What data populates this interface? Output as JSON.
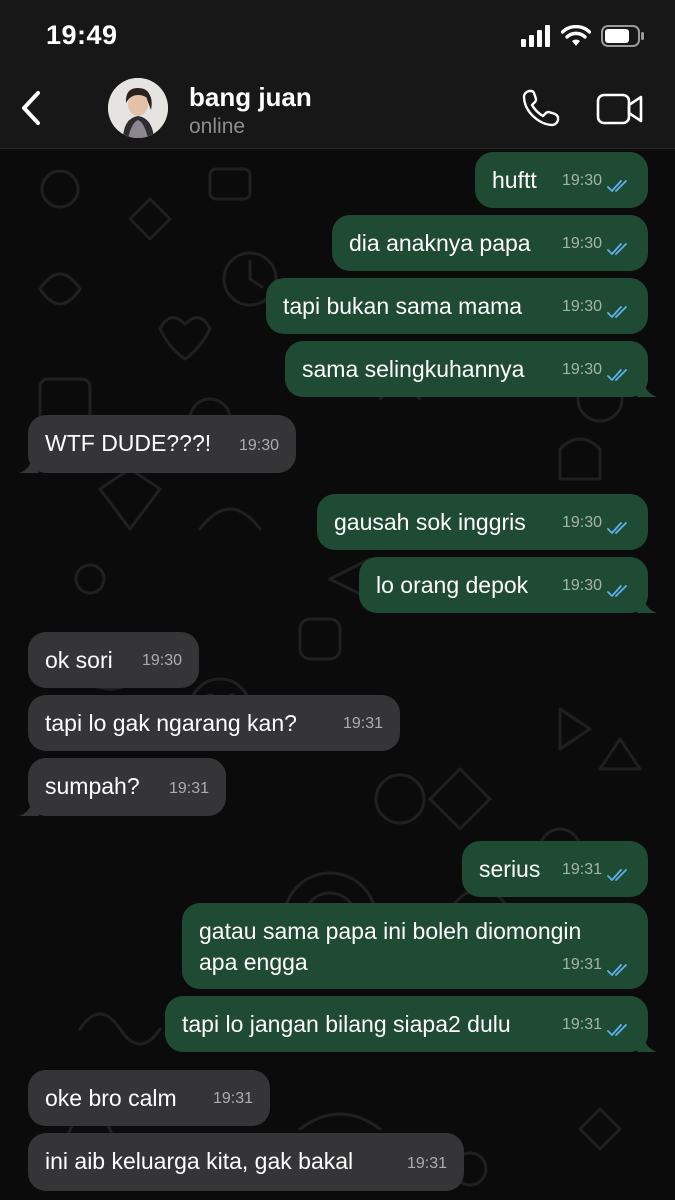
{
  "status_bar": {
    "time": "19:49"
  },
  "header": {
    "contact_name": "bang juan",
    "contact_status": "online"
  },
  "colors": {
    "outgoing_bubble": "#1f4a33",
    "incoming_bubble": "#353537",
    "read_check": "#5fb0f0",
    "background": "#0b0b0b"
  },
  "messages": [
    {
      "dir": "out",
      "text": "huftt",
      "time": "19:30",
      "read": true
    },
    {
      "dir": "out",
      "text": "dia anaknya papa",
      "time": "19:30",
      "read": true
    },
    {
      "dir": "out",
      "text": "tapi bukan sama mama",
      "time": "19:30",
      "read": true
    },
    {
      "dir": "out",
      "text": "sama selingkuhannya",
      "time": "19:30",
      "read": true
    },
    {
      "dir": "in",
      "text": "WTF DUDE???!",
      "time": "19:30"
    },
    {
      "dir": "out",
      "text": "gausah sok inggris",
      "time": "19:30",
      "read": true
    },
    {
      "dir": "out",
      "text": "lo orang depok",
      "time": "19:30",
      "read": true
    },
    {
      "dir": "in",
      "text": "ok sori",
      "time": "19:30"
    },
    {
      "dir": "in",
      "text": "tapi lo gak ngarang kan?",
      "time": "19:31"
    },
    {
      "dir": "in",
      "text": "sumpah?",
      "time": "19:31"
    },
    {
      "dir": "out",
      "text": "serius",
      "time": "19:31",
      "read": true
    },
    {
      "dir": "out",
      "text": "gatau sama papa ini boleh diomongin\napa engga",
      "time": "19:31",
      "read": true
    },
    {
      "dir": "out",
      "text": "tapi lo jangan bilang siapa2 dulu",
      "time": "19:31",
      "read": true
    },
    {
      "dir": "in",
      "text": "oke bro calm",
      "time": "19:31"
    },
    {
      "dir": "in",
      "text": "ini aib keluarga kita, gak bakal",
      "time": "19:31"
    }
  ]
}
